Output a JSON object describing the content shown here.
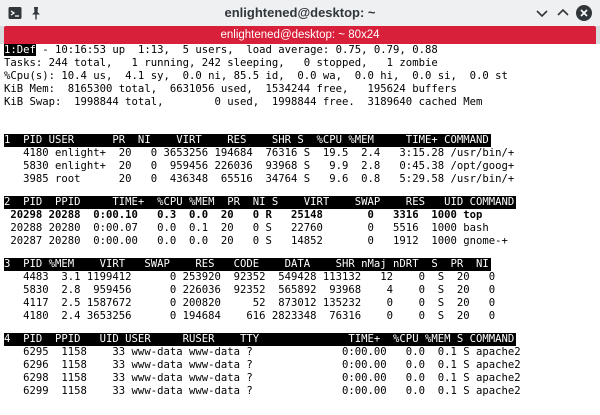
{
  "window": {
    "title": "enlightened@desktop: ~",
    "tab_title": "enlightened@desktop: ~ 80x24"
  },
  "colors": {
    "tab_bg": "#d9203a",
    "title_bg": "#eff0f1",
    "terminal_bg": "#ffffff",
    "terminal_fg": "#000000"
  },
  "icons": {
    "app": "terminal-icon",
    "pin": "pin-icon",
    "minimize": "chevron-down-icon",
    "maximize": "chevron-up-icon",
    "close": "close-icon"
  },
  "summary": {
    "line1": "1:Def - 10:16:53 up  1:13,  5 users,  load average: 0.75, 0.79, 0.88",
    "tasks": "Tasks: 244 total,   1 running, 242 sleeping,   0 stopped,   1 zombie",
    "cpu": "%Cpu(s): 10.4 us,  4.1 sy,  0.0 ni, 85.5 id,  0.0 wa,  0.0 hi,  0.0 si,  0.0 st",
    "mem": "KiB Mem:  8165300 total,  6631056 used,  1534244 free,   195624 buffers",
    "swap": "KiB Swap:  1998844 total,        0 used,  1998844 free.  3189640 cached Mem"
  },
  "panels": [
    {
      "header": "1  PID USER      PR  NI    VIRT    RES    SHR S  %CPU %MEM     TIME+ COMMAND",
      "rows": [
        "   4180 enlight+  20   0 3653256 194684  76316 S  19.5  2.4   3:15.28 /usr/bin/+",
        "   5830 enlight+  20   0  959456 226036  93968 S   9.9  2.8   0:45.38 /opt/goog+",
        "   3985 root      20   0  436348  65516  34764 S   9.6  0.8   5:29.58 /usr/bin/+"
      ]
    },
    {
      "header": "2  PID  PPID     TIME+  %CPU %MEM  PR  NI S    VIRT    SWAP    RES   UID COMMAND",
      "rows": [
        " 20298 20288  0:00.10   0.3  0.0  20   0 R   25148       0   3316  1000 top",
        " 20288 20280  0:00.07   0.0  0.1  20   0 S   22760       0   5516  1000 bash",
        " 20287 20280  0:00.00   0.0  0.0  20   0 S   14852       0   1912  1000 gnome-+"
      ]
    },
    {
      "header": "3  PID %MEM    VIRT   SWAP    RES   CODE    DATA    SHR nMaj nDRT  S  PR  NI",
      "rows": [
        "   4483  3.1 1199412      0 253920  92352  549428 113132   12    0  S  20   0",
        "   5830  2.8  959456      0 226036  92352  565892  93968    4    0  S  20   0",
        "   4117  2.5 1587672      0 200820     52  873012 135232    0    0  S  20   0",
        "   4180  2.4 3653256      0 194684    616 2823348  76316    0    0  S  20   0"
      ]
    },
    {
      "header": "4  PID  PPID   UID USER     RUSER    TTY              TIME+  %CPU %MEM S COMMAND",
      "rows": [
        "   6295  1158    33 www-data www-data ?              0:00.00   0.0  0.1 S apache2",
        "   6296  1158    33 www-data www-data ?              0:00.00   0.0  0.1 S apache2",
        "   6298  1158    33 www-data www-data ?              0:00.00   0.0  0.1 S apache2",
        "   6299  1158    33 www-data www-data ?              0:00.00   0.0  0.1 S apache2"
      ]
    }
  ]
}
